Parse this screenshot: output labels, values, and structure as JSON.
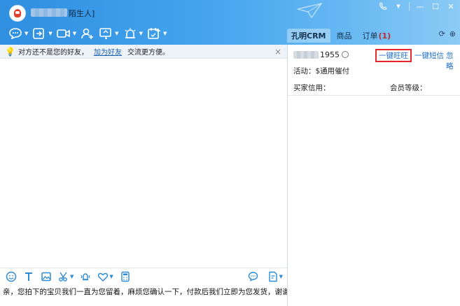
{
  "header": {
    "contact_tag": "陌生人]",
    "window_controls": {
      "phone_icon": "phone-icon",
      "menu_icon": "caret-down-icon",
      "minimize": "—",
      "maximize": "☐",
      "close": "✕"
    }
  },
  "toolbar": {
    "items": [
      {
        "name": "chat-bubble",
        "has_caret": true
      },
      {
        "name": "transfer-file",
        "has_caret": true
      },
      {
        "name": "video-call",
        "has_caret": true
      },
      {
        "name": "add-contact",
        "has_caret": false
      },
      {
        "name": "screen-share",
        "has_caret": true
      },
      {
        "name": "remote-assist",
        "has_caret": true
      },
      {
        "name": "app-store",
        "has_caret": true
      }
    ]
  },
  "right_tabs": {
    "crm": "孔明CRM",
    "goods": "商品",
    "orders": "订单",
    "orders_count": "(1)"
  },
  "notice": {
    "text_before": "对方还不是您的好友，",
    "link": "加为好友",
    "text_after": "交流更方便。",
    "close": "×"
  },
  "right_panel": {
    "number_suffix": "1955",
    "action_wangwang": "一键旺旺",
    "action_sms": "一键短信",
    "action_ignore": "忽略",
    "activity": "活动：$通用催付",
    "buyer_credit": "买家信用：",
    "member_level": "会员等级："
  },
  "input": {
    "message": "亲，您拍下的宝贝我们一直为您留着，麻烦您确认一下，付款后我们立即为您发货，谢谢!"
  },
  "colors": {
    "header_blue": "#2f8fe0",
    "link_blue": "#1a5fb4",
    "highlight_red": "#e5262b"
  }
}
